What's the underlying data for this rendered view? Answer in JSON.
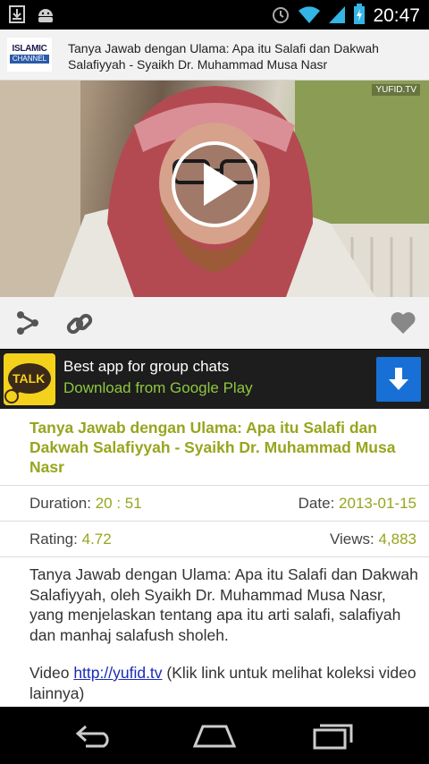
{
  "status_bar": {
    "time": "20:47",
    "left_icons": [
      "download-icon",
      "android-icon"
    ],
    "right_icons": [
      "alarm-icon",
      "wifi-icon",
      "signal-icon",
      "battery-icon"
    ]
  },
  "header": {
    "logo_top": "ISLAMIC",
    "logo_bottom": "CHANNEL",
    "title": "Tanya Jawab dengan Ulama: Apa itu Salafi dan Dakwah Salafiyyah - Syaikh Dr. Muhammad Musa Nasr"
  },
  "video": {
    "watermark": "YUFID.TV",
    "play_icon": "play-icon"
  },
  "actions": {
    "share_icon": "share-icon",
    "link_icon": "link-icon",
    "favorite_icon": "heart-icon"
  },
  "ad": {
    "logo_text": "TALK",
    "title": "Best app for group chats",
    "subtitle": "Download from Google Play",
    "button_icon": "download-arrow-icon"
  },
  "details": {
    "title": "Tanya Jawab dengan Ulama: Apa itu Salafi dan Dakwah Salafiyyah - Syaikh Dr. Muhammad Musa Nasr",
    "duration_label": "Duration:",
    "duration_value": "20 : 51",
    "date_label": "Date:",
    "date_value": "2013-01-15",
    "rating_label": "Rating:",
    "rating_value": "4.72",
    "views_label": "Views:",
    "views_value": "4,883",
    "description": "Tanya Jawab dengan Ulama: Apa itu Salafi dan Dakwah Salafiyyah, oleh Syaikh Dr. Muhammad Musa Nasr, yang menjelaskan tentang apa itu arti salafi, salafiyah dan manhaj salafush sholeh.",
    "video_prefix": "Video",
    "video_link": "http://yufid.tv",
    "video_suffix": "(Klik link untuk melihat koleksi video lainnya)"
  },
  "colors": {
    "accent": "#97a51e",
    "ad_green": "#8ec640",
    "ad_button": "#1870d6",
    "link": "#1a2bb8"
  },
  "nav": {
    "back_icon": "back-icon",
    "home_icon": "home-icon",
    "recents_icon": "recents-icon"
  }
}
